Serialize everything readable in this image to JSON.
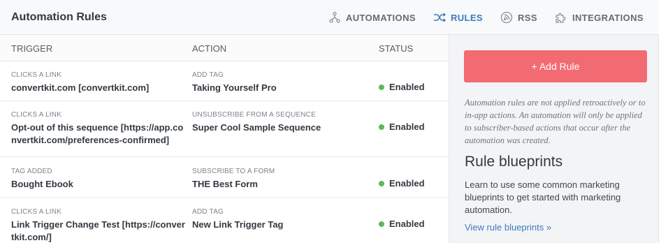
{
  "header": {
    "title": "Automation Rules",
    "nav": [
      {
        "label": "AUTOMATIONS",
        "icon": "automations-icon"
      },
      {
        "label": "RULES",
        "icon": "shuffle-icon",
        "active": true
      },
      {
        "label": "RSS",
        "icon": "rss-icon"
      },
      {
        "label": "INTEGRATIONS",
        "icon": "puzzle-icon"
      }
    ]
  },
  "table": {
    "columns": {
      "trigger": "TRIGGER",
      "action": "ACTION",
      "status": "STATUS"
    },
    "rows": [
      {
        "trigger_type": "CLICKS A LINK",
        "trigger_value": "convertkit.com [convertkit.com]",
        "action_type": "ADD TAG",
        "action_value": "Taking Yourself Pro",
        "status": "Enabled"
      },
      {
        "trigger_type": "CLICKS A LINK",
        "trigger_value": "Opt-out of this sequence [https://app.convertkit.com/preferences-confirmed]",
        "action_type": "UNSUBSCRIBE FROM A SEQUENCE",
        "action_value": "Super Cool Sample Sequence",
        "status": "Enabled"
      },
      {
        "trigger_type": "TAG ADDED",
        "trigger_value": "Bought Ebook",
        "action_type": "SUBSCRIBE TO A FORM",
        "action_value": "THE Best Form",
        "status": "Enabled"
      },
      {
        "trigger_type": "CLICKS A LINK",
        "trigger_value": "Link Trigger Change Test [https://convertkit.com/]",
        "action_type": "ADD TAG",
        "action_value": "New Link Trigger Tag",
        "status": "Enabled"
      }
    ]
  },
  "sidebar": {
    "add_button": "+ Add Rule",
    "note": "Automation rules are not applied retroactively or to in-app actions. An automation will only be applied to subscriber-based actions that occur after the automation was created.",
    "blueprints_heading": "Rule blueprints",
    "blueprints_desc": "Learn to use some common marketing blueprints to get started with marketing automation.",
    "blueprints_link": "View rule blueprints »"
  },
  "colors": {
    "accent": "#3d7bbf",
    "add_button": "#f26b73",
    "enabled_dot": "#5cb85c"
  }
}
